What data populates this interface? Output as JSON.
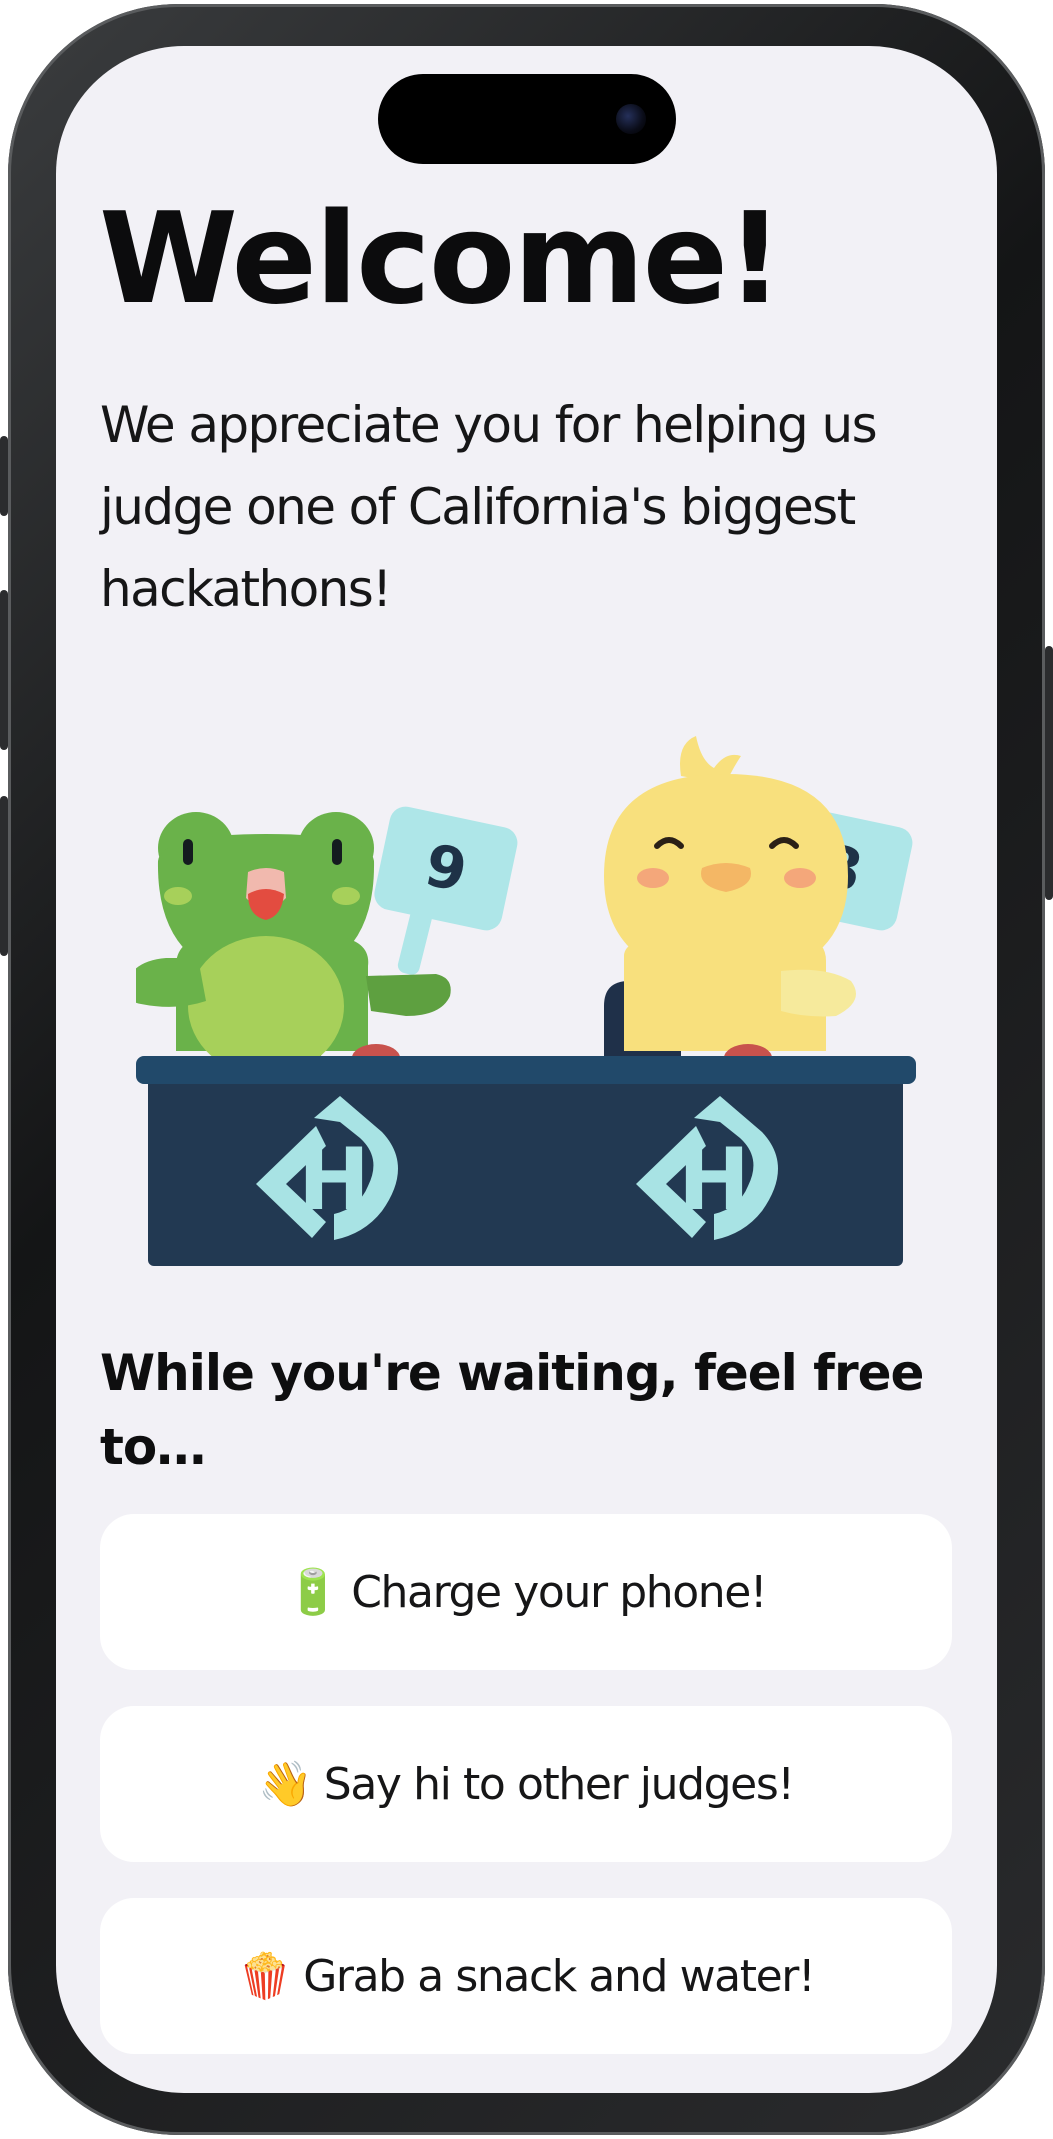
{
  "welcome": {
    "title": "Welcome!",
    "intro": "We appreciate you for helping us judge one of California's biggest hackathons!"
  },
  "illustration": {
    "left_score": "9",
    "right_score": "8",
    "logo_letter": "H",
    "colors": {
      "frog": "#6ab24a",
      "duck": "#f8e07d",
      "desk": "#223952",
      "desk_top": "#21496a",
      "logo": "#a8e3e4",
      "sign": "#aee6e8"
    }
  },
  "waiting": {
    "heading": "While you're waiting, feel free to…",
    "tasks": [
      {
        "icon": "battery-icon",
        "emoji": "🔋",
        "label": "Charge your phone!"
      },
      {
        "icon": "waving-hand-icon",
        "emoji": "👋",
        "label": "Say hi to other judges!"
      },
      {
        "icon": "popcorn-icon",
        "emoji": "🍿",
        "label": "Grab a snack and water!"
      }
    ]
  }
}
